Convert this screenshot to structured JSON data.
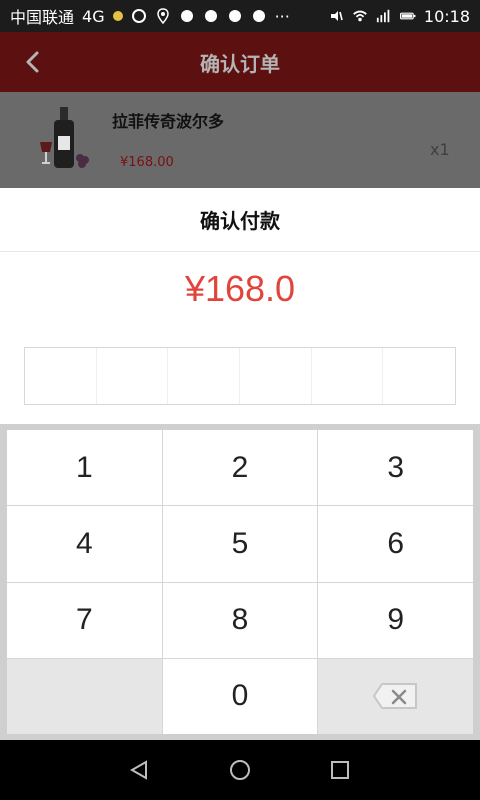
{
  "status_bar": {
    "carrier": "中国联通",
    "network": "4G",
    "time": "10:18",
    "icons": [
      "dot-icon",
      "chat-icon",
      "location-icon",
      "qq-icon",
      "qq-icon",
      "qq-icon",
      "qq-icon",
      "more-icon",
      "mute-icon",
      "wifi-icon",
      "signal-icon",
      "battery-icon"
    ]
  },
  "header": {
    "title": "确认订单"
  },
  "order": {
    "item_name": "拉菲传奇波尔多",
    "price": "¥168.00",
    "qty": "x1"
  },
  "payment": {
    "title": "确认付款",
    "amount": "¥168.0",
    "pin_length": 6
  },
  "keypad": {
    "keys": [
      "1",
      "2",
      "3",
      "4",
      "5",
      "6",
      "7",
      "8",
      "9",
      "",
      "0",
      "delete"
    ]
  },
  "nav": {
    "buttons": [
      "back-nav-icon",
      "home-nav-icon",
      "recent-apps-icon"
    ]
  }
}
